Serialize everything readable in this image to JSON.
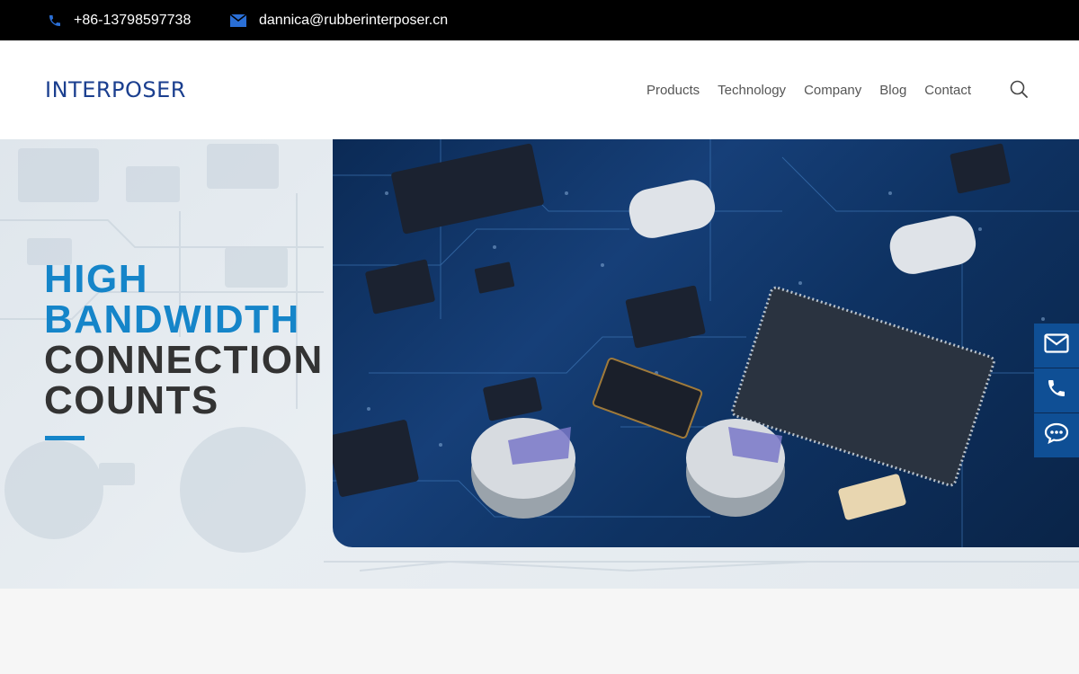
{
  "topbar": {
    "phone": "+86-13798597738",
    "email": "dannica@rubberinterposer.cn",
    "phone_icon": "phone-icon",
    "email_icon": "envelope-icon"
  },
  "header": {
    "logo_text": "INTERPOSER",
    "nav": [
      "Products",
      "Technology",
      "Company",
      "Blog",
      "Contact"
    ],
    "search_icon": "search-icon"
  },
  "hero": {
    "line1": "HIGH",
    "line2": "BANDWIDTH",
    "line3": "CONNECTION",
    "line4": "COUNTS"
  },
  "side_contact": {
    "icons": [
      "envelope-icon",
      "phone-icon",
      "chat-icon"
    ]
  },
  "colors": {
    "accent": "#1585c9",
    "brand": "#1b3f8f",
    "side_button": "#0f4f95",
    "topbar": "#000000"
  }
}
